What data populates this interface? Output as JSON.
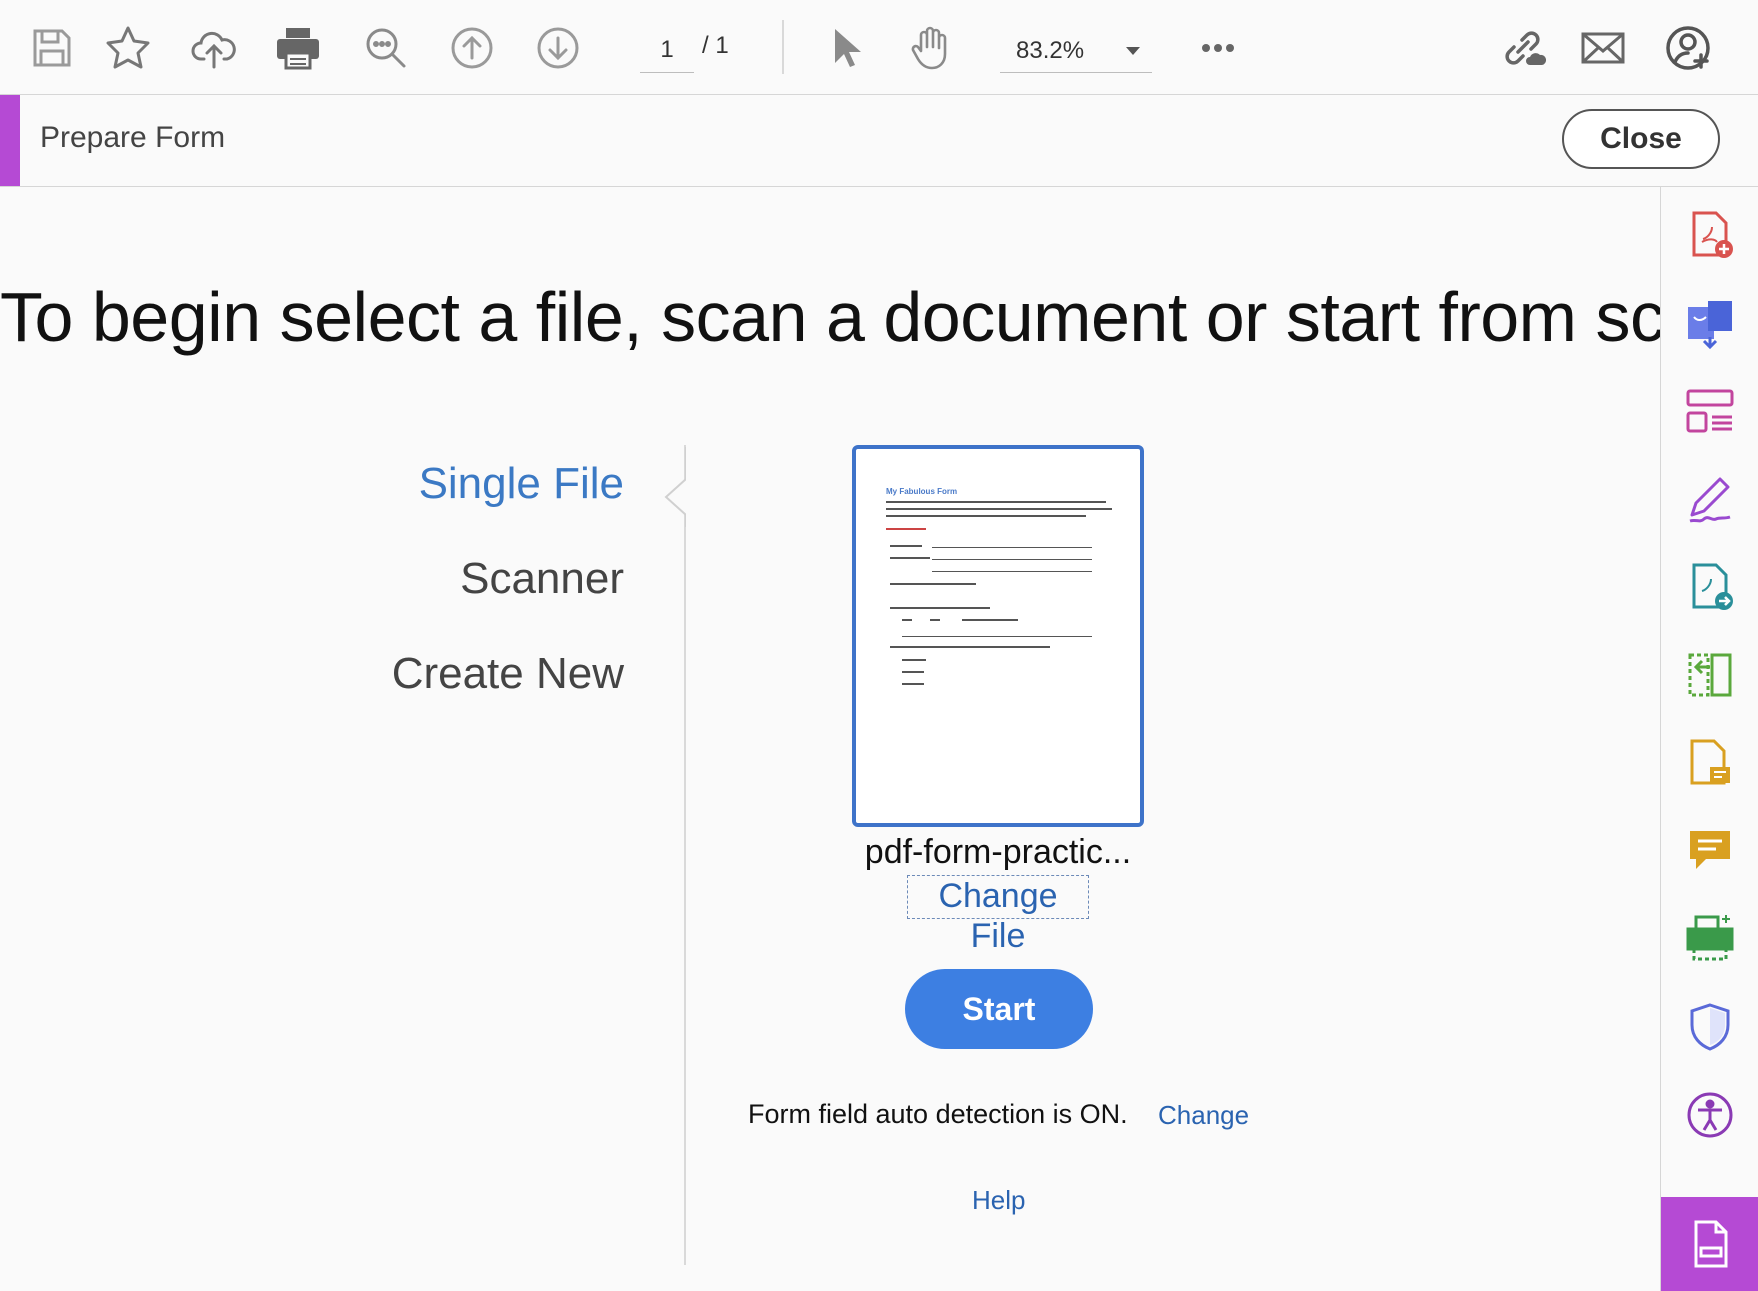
{
  "toolbar": {
    "page_current": "1",
    "page_total": "/ 1",
    "zoom": "83.2%",
    "icons": [
      "save-icon",
      "bookmark-star-icon",
      "cloud-upload-icon",
      "print-icon",
      "find-text-icon",
      "previous-page-icon",
      "next-page-icon",
      "select-cursor-icon",
      "hand-tool-icon",
      "more-options-icon",
      "share-link-icon",
      "email-icon",
      "sign-in-account-icon"
    ]
  },
  "tool_header": {
    "title": "Prepare Form",
    "close_label": "Close",
    "accent": "#b54ad4"
  },
  "main": {
    "headline": "To begin select a file, scan a document or start from scratch",
    "options": [
      {
        "label": "Single File",
        "active": true
      },
      {
        "label": "Scanner",
        "active": false
      },
      {
        "label": "Create New",
        "active": false
      }
    ],
    "thumbnail_doc_title": "My Fabulous Form",
    "file_name": "pdf-form-practic...",
    "change_file_label": "Change File",
    "start_label": "Start",
    "auto_detection_text": "Form field auto detection is ON.",
    "auto_detection_change": "Change",
    "help_label": "Help"
  },
  "right_panel": {
    "tools": [
      "create-pdf-icon",
      "combine-files-icon",
      "organize-pages-icon",
      "fill-sign-icon",
      "export-pdf-icon",
      "compare-files-icon",
      "edit-pdf-icon",
      "comment-icon",
      "print-production-icon",
      "protect-icon",
      "accessibility-icon",
      "prepare-form-icon"
    ]
  },
  "colors": {
    "link": "#2a63b0",
    "primary_button": "#3d7fe2",
    "thumbnail_border": "#3e73c9",
    "active_tool": "#b54ad4"
  }
}
